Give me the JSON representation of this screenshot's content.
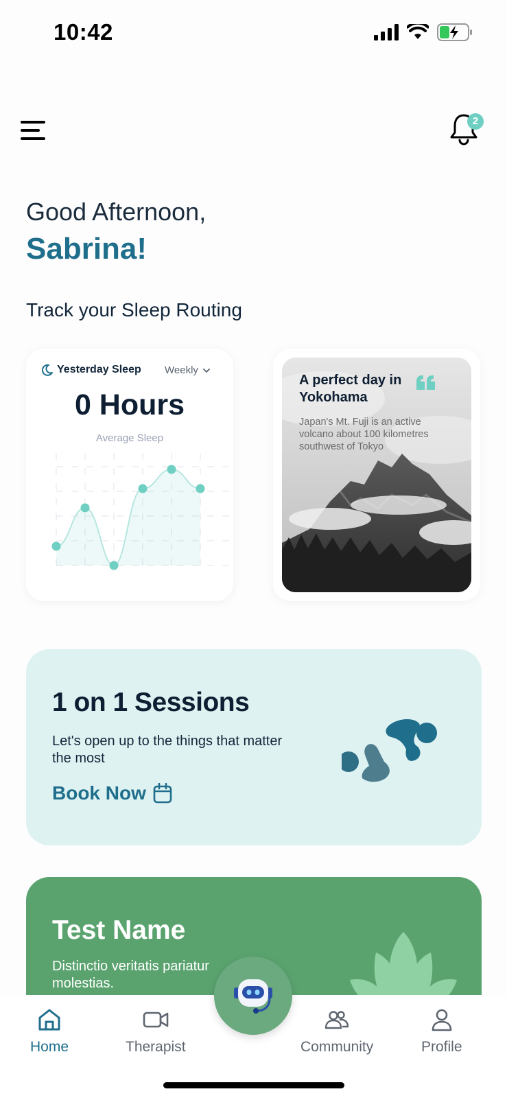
{
  "status_bar": {
    "time": "10:42"
  },
  "header": {
    "notification_count": "2"
  },
  "greeting": {
    "salutation": "Good Afternoon,",
    "name": "Sabrina!"
  },
  "sleep_section": {
    "title": "Track your Sleep Routing",
    "card": {
      "label": "Yesterday Sleep",
      "period": "Weekly",
      "hours": "0 Hours",
      "subtitle": "Average Sleep"
    }
  },
  "quote_card": {
    "title": "A perfect day in Yokohama",
    "text": "Japan's Mt. Fuji is an active volcano about 100 kilometres southwest of Tokyo"
  },
  "sessions_card": {
    "title": "1 on 1 Sessions",
    "description": "Let's open up to the things that matter the most",
    "cta": "Book Now"
  },
  "test_card": {
    "title": "Test Name",
    "description": "Distinctio veritatis pariatur molestias."
  },
  "bottom_nav": {
    "items": [
      {
        "label": "Home",
        "icon": "home-icon",
        "active": true
      },
      {
        "label": "Therapist",
        "icon": "video-icon",
        "active": false
      },
      {
        "label": "Community",
        "icon": "community-icon",
        "active": false
      },
      {
        "label": "Profile",
        "icon": "profile-icon",
        "active": false
      }
    ]
  },
  "colors": {
    "primary": "#1e6e8c",
    "accent": "#6fcfc2",
    "sessions_bg": "#dff2f2",
    "test_bg": "#5aa36f"
  }
}
